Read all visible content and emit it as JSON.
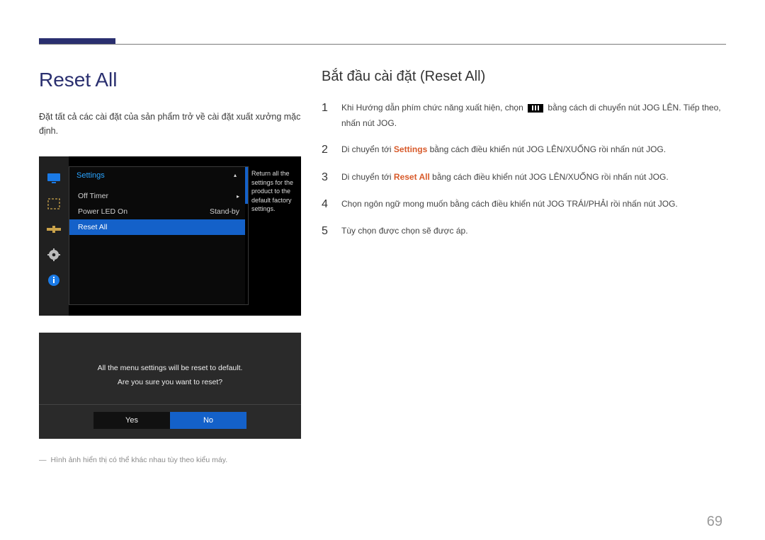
{
  "header": {
    "tab_color": "#2a2f6f"
  },
  "left": {
    "title": "Reset All",
    "subtitle": "Đặt tất cả các cài đặt của sản phẩm trở về cài đặt xuất xưởng mặc định.",
    "osd": {
      "header_label": "Settings",
      "rows": [
        {
          "label": "Off Timer",
          "value": "",
          "selected": false,
          "has_chevron": true
        },
        {
          "label": "Power LED On",
          "value": "Stand-by",
          "selected": false,
          "has_chevron": false
        },
        {
          "label": "Reset All",
          "value": "",
          "selected": true,
          "has_chevron": false
        }
      ],
      "help_text": "Return all the settings for the product to the default factory settings.",
      "sidebar_icons": [
        "monitor-icon",
        "square-icon",
        "slider-icon",
        "gear-icon",
        "info-icon"
      ],
      "arrow_up": "▴"
    },
    "confirm": {
      "line1": "All the menu settings will be reset to default.",
      "line2": "Are you sure you want to reset?",
      "yes": "Yes",
      "no": "No"
    },
    "footnote_dash": "―",
    "footnote": "Hình ảnh hiển thị có thể khác nhau tùy theo kiểu máy."
  },
  "right": {
    "title": "Bắt đầu cài đặt (Reset All)",
    "steps": {
      "s1_num": "1",
      "s1_a": "Khi Hướng dẫn phím chức năng xuất hiện, chọn ",
      "s1_b": " bằng cách di chuyển nút JOG LÊN. Tiếp theo, nhấn nút JOG.",
      "s2_num": "2",
      "s2_a": "Di chuyển tới ",
      "s2_hl": "Settings",
      "s2_b": " bằng cách điều khiển nút JOG LÊN/XUỐNG rồi nhấn nút JOG.",
      "s3_num": "3",
      "s3_a": "Di chuyển tới ",
      "s3_hl": "Reset All",
      "s3_b": " bằng cách điều khiển nút JOG LÊN/XUỐNG rồi nhấn nút JOG.",
      "s4_num": "4",
      "s4": "Chọn ngôn ngữ mong muốn bằng cách điều khiển nút JOG TRÁI/PHẢI rồi nhấn nút JOG.",
      "s5_num": "5",
      "s5": "Tùy chọn được chọn sẽ được áp."
    }
  },
  "page_number": "69"
}
